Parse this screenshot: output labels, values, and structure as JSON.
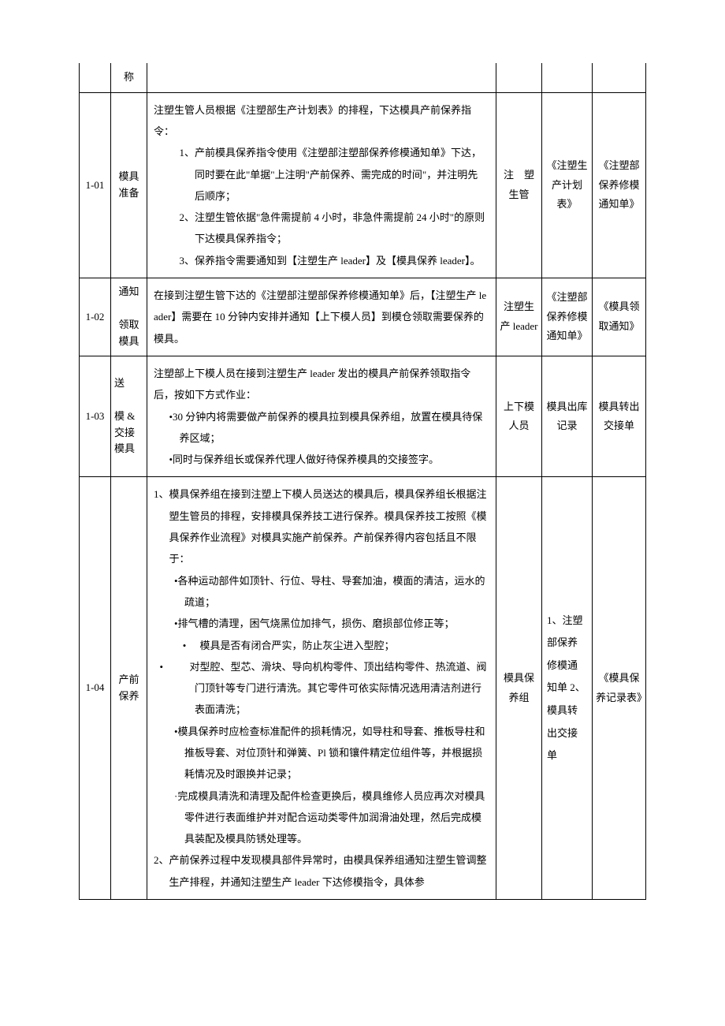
{
  "header": {
    "col2_partial": "称"
  },
  "rows": [
    {
      "id": "1-01",
      "name": "模具准备",
      "desc": {
        "p1": "注塑生管人员根据《注塑部生产计划表》的排程，下达模具产前保养指令：",
        "p2": "1、产前模具保养指令使用《注塑部注塑部保养修模通知单》下达，同时要在此\"单据\"上注明\"产前保养、需完成的时间\"，并注明先后顺序；",
        "p3": "2、注塑生管依据\"急件需提前 4 小时，非急件需提前 24 小时\"的原则下达模具保养指令；",
        "p4": "3、保养指令需要通知到【注塑生产 leader】及【模具保养 leader】。"
      },
      "resp": "注　塑生管",
      "ref1": "《注塑生产计划表》",
      "ref2": "《注塑部保养修模通知单》"
    },
    {
      "id": "1-02",
      "name": "通知\n\n领取模具",
      "desc": {
        "p1": "在接到注塑生管下达的《注塑部注塑部保养修模通知单》后，【注塑生产 leader】需要在 10 分钟内安排并通知【上下模人员】到模仓领取需要保养的模具。"
      },
      "resp": "注塑生产 leader",
      "ref1": "《注塑部保养修模通知单》",
      "ref2": "《模具领取通知》"
    },
    {
      "id": "1-03",
      "name": "送\n\n模 & 交接模具",
      "desc": {
        "p1": "注塑部上下模人员在接到注塑生产 leader 发出的模具产前保养领取指令后，按如下方式作业：",
        "b1": "•30 分钟内将需要做产前保养的模具拉到模具保养组，放置在模具待保养区域；",
        "b2": "•同时与保养组长或保养代理人做好待保养模具的交接签字。"
      },
      "resp": "上下模人员",
      "ref1": "模具出库记录",
      "ref2": "模具转出交接单"
    },
    {
      "id": "1-04",
      "name": "产前保养",
      "desc": {
        "p1": "1、模具保养组在接到注塑上下模人员送达的模具后，模具保养组长根据注塑生管员的排程，安排模具保养技工进行保养。模具保养技工按照《模具保养作业流程》对模具实施产前保养。产前保养得内容包括且不限于：",
        "b1": "•各种运动部件如顶针、行位、导柱、导套加油，模面的清洁，运水的疏道；",
        "b2": "•排气槽的清理，困气烧黑位加排气，损伤、磨损部位修正等；",
        "b3": "模具是否有闭合严实，防止灰尘进入型腔；",
        "b4": "对型腔、型芯、滑块、导向机构零件、顶出结构零件、热流道、阀门顶针等专门进行清洗。其它零件可依实际情况选用清洁剂进行表面清洗；",
        "b5": "•模具保养时应检查标准配件的损耗情况，如导柱和导套、推板导柱和推板导套、对位顶针和弹簧、Pl 锁和镶件精定位组件等，并根据损耗情况及时跟换并记录；",
        "b6": "·完成模具清洗和清理及配件检查更换后，模具维修人员应再次对模具零件进行表面维护并对配合运动类零件加润滑油处理，然后完成模具装配及模具防锈处理等。",
        "p2": "2、产前保养过程中发现模具部件异常时，由模具保养组通知注塑生管调整生产排程，并通知注塑生产 leader 下达修模指令，具体参"
      },
      "resp": "模具保养组",
      "ref1": "1、注塑部保养修模通知单 2、模具转出交接单",
      "ref2": "《模具保养记录表》"
    }
  ]
}
